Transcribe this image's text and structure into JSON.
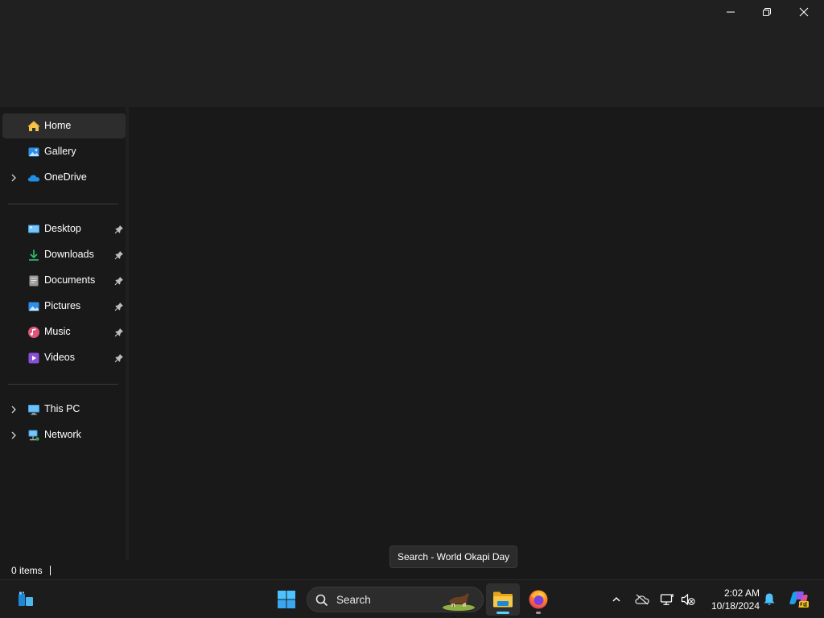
{
  "window": {
    "controls": {
      "minimize_icon": "minimize-icon",
      "maximize_icon": "restore-icon",
      "close_icon": "close-icon"
    }
  },
  "navigation": {
    "quick": [
      {
        "label": "Home",
        "icon": "home-icon",
        "selected": true
      },
      {
        "label": "Gallery",
        "icon": "gallery-icon"
      },
      {
        "label": "OneDrive",
        "icon": "onedrive-icon",
        "expandable": true
      }
    ],
    "pinned": [
      {
        "label": "Desktop",
        "icon": "desktop-icon",
        "pinned": true
      },
      {
        "label": "Downloads",
        "icon": "downloads-icon",
        "pinned": true
      },
      {
        "label": "Documents",
        "icon": "documents-icon",
        "pinned": true
      },
      {
        "label": "Pictures",
        "icon": "pictures-icon",
        "pinned": true
      },
      {
        "label": "Music",
        "icon": "music-icon",
        "pinned": true
      },
      {
        "label": "Videos",
        "icon": "videos-icon",
        "pinned": true
      }
    ],
    "devices": [
      {
        "label": "This PC",
        "icon": "this-pc-icon",
        "expandable": true
      },
      {
        "label": "Network",
        "icon": "network-icon",
        "expandable": true
      }
    ]
  },
  "status": {
    "items_count": "0 items"
  },
  "tooltip": {
    "text": "Search - World Okapi Day"
  },
  "taskbar": {
    "search_placeholder": "Search",
    "clock_time": "2:02 AM",
    "clock_date": "10/18/2024",
    "apps": [
      "File Explorer",
      "Firefox"
    ]
  },
  "colors": {
    "accent": "#60cdff",
    "background": "#191919",
    "titlebar": "#202020",
    "selected": "#2d2d2d"
  }
}
